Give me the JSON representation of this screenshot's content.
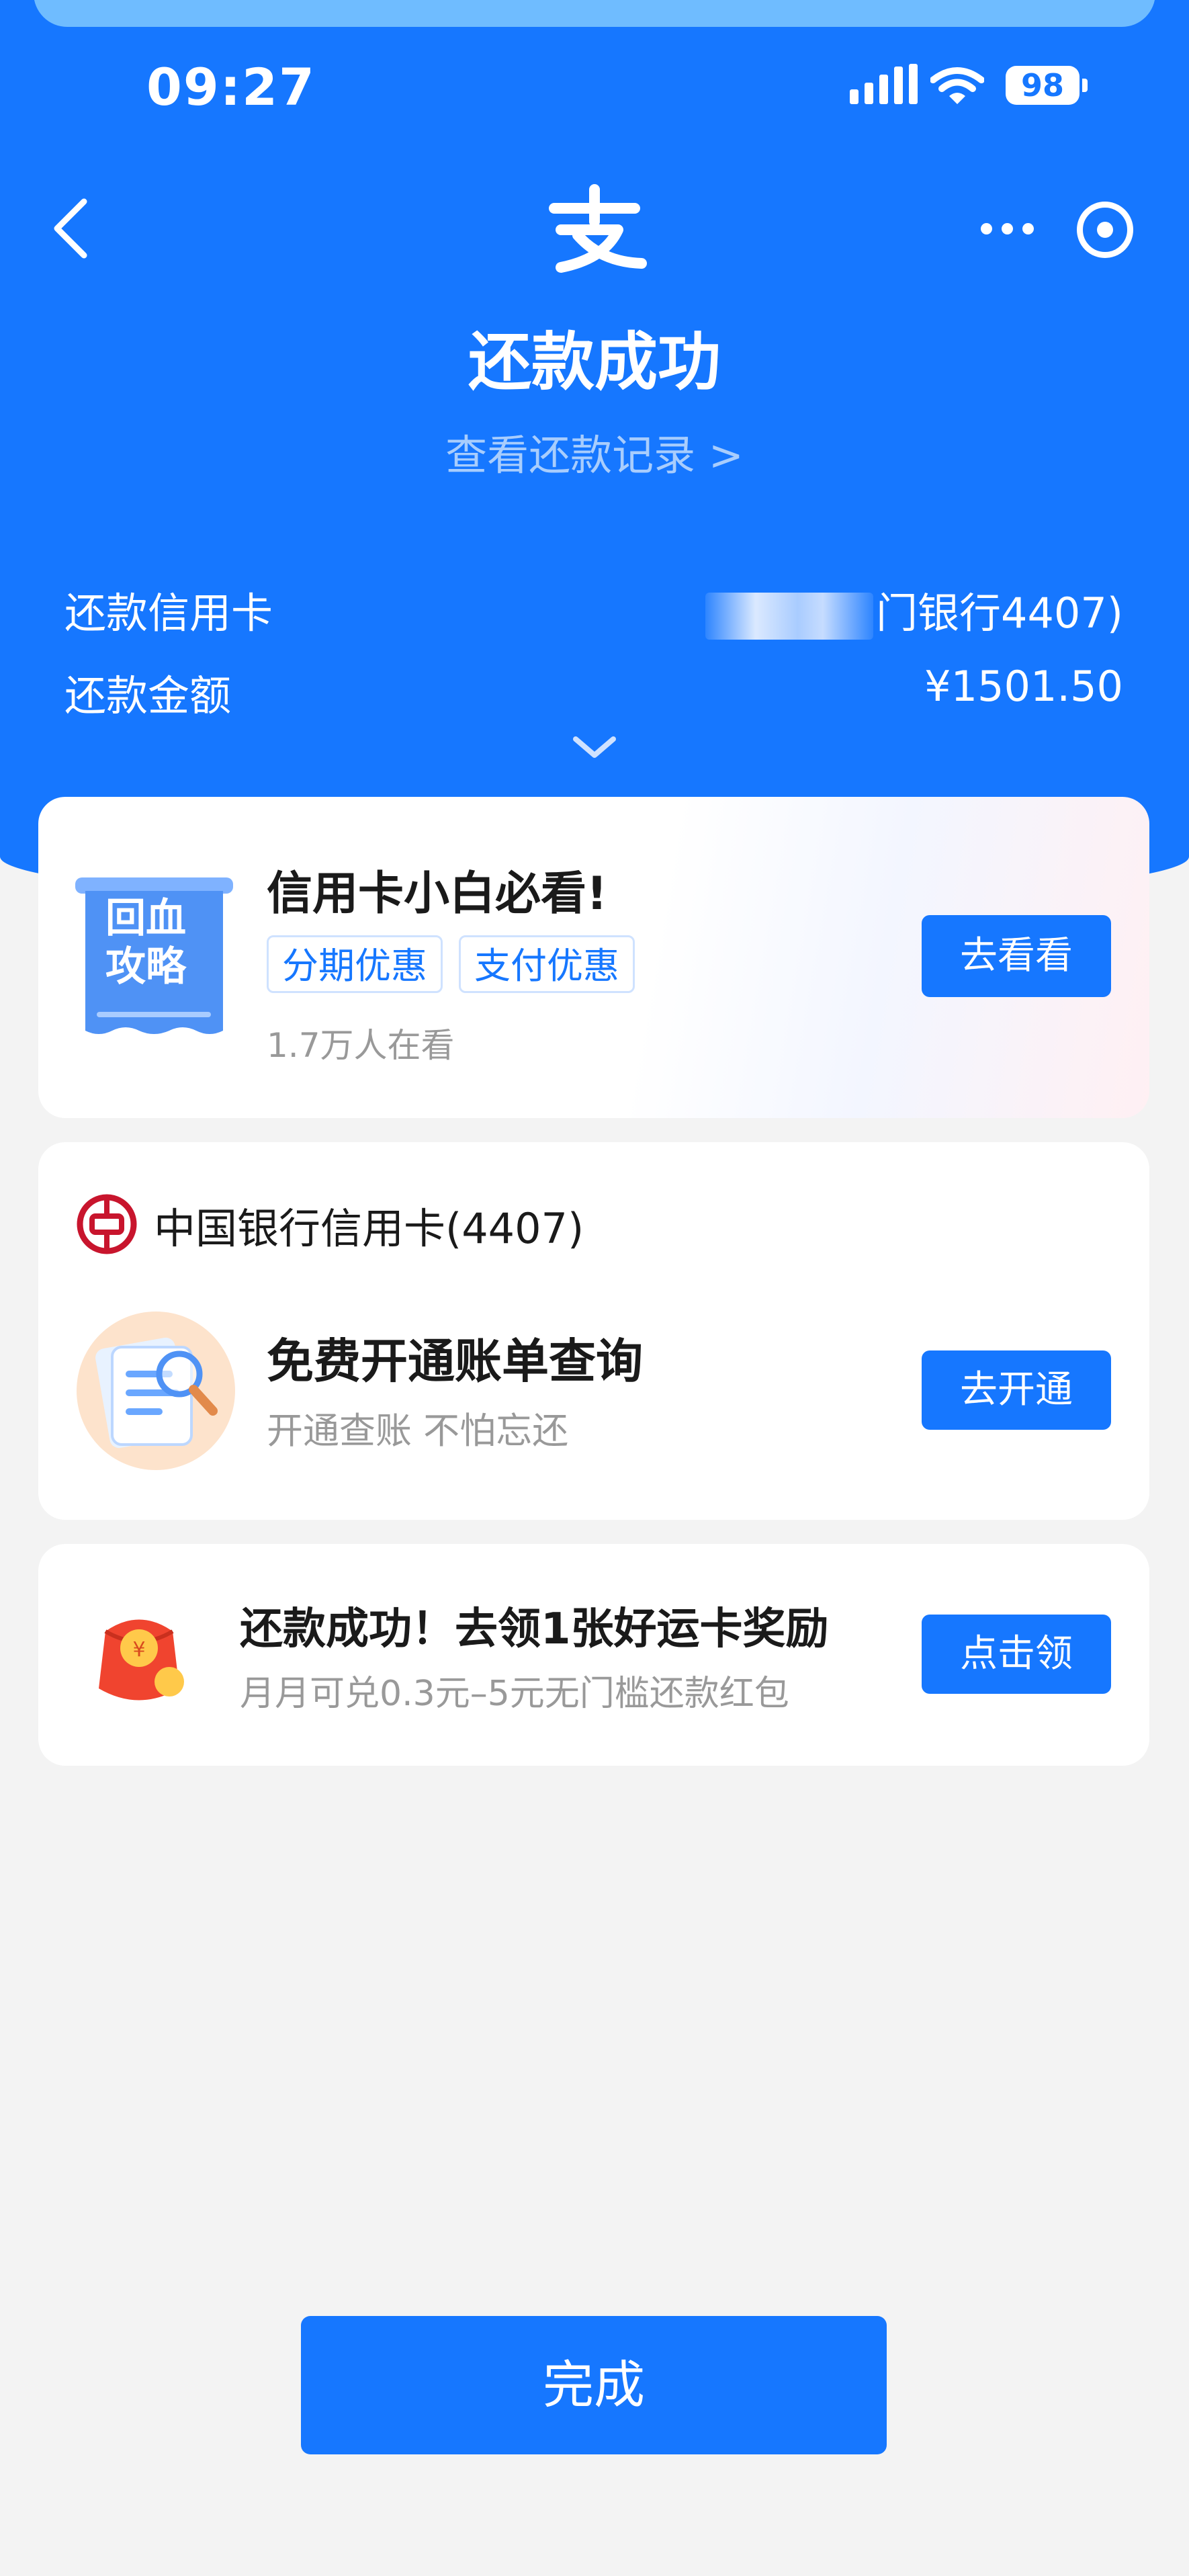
{
  "status_bar": {
    "time": "09:27",
    "battery": "98"
  },
  "header": {
    "title": "还款成功",
    "record_link": "查看还款记录 >",
    "card_label": "还款信用卡",
    "card_value": "门银行4407)",
    "amount_label": "还款金额",
    "amount_value": "¥1501.50"
  },
  "guide_card": {
    "badge_text_1": "回血",
    "badge_text_2": "攻略",
    "title": "信用卡小白必看!",
    "tags": [
      "分期优惠",
      "支付优惠"
    ],
    "viewers": "1.7万人在看",
    "button": "去看看"
  },
  "bank_card": {
    "bank_name": "中国银行信用卡(4407)",
    "title": "免费开通账单查询",
    "subtitle": "开通查账 不怕忘还",
    "button": "去开通"
  },
  "reward_card": {
    "title": "还款成功！去领1张好运卡奖励",
    "subtitle": "月月可兑0.3元–5元无门槛还款红包",
    "button": "点击领"
  },
  "footer": {
    "done_button": "完成"
  },
  "colors": {
    "primary": "#1677ff",
    "background": "#f3f3f3"
  }
}
